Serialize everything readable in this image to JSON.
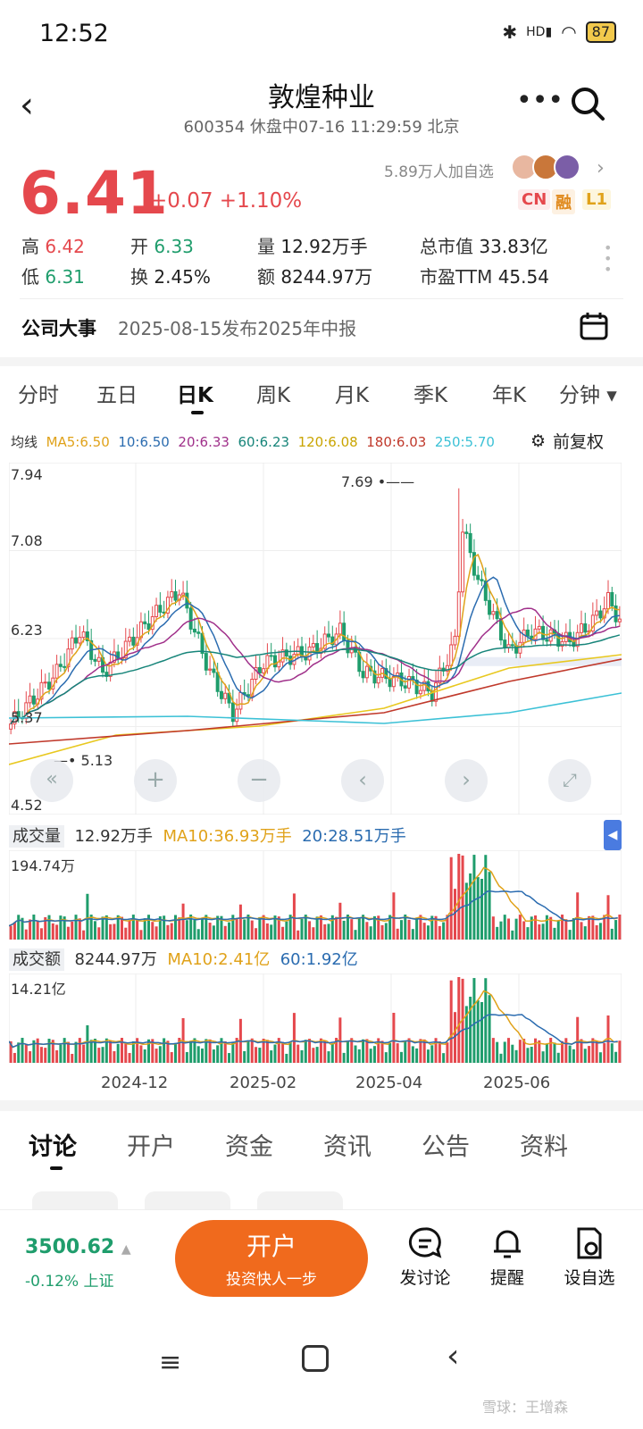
{
  "status": {
    "time": "12:52",
    "battery": "87",
    "network": "HD"
  },
  "header": {
    "title": "敦煌种业",
    "subtitle": "600354 休盘中07-16 11:29:59 北京"
  },
  "quote": {
    "price": "6.41",
    "change": "+0.07 +1.10%",
    "followers": "5.89万人加自选",
    "tags": [
      "CN",
      "融",
      "L1"
    ],
    "stats": {
      "high_label": "高",
      "high": "6.42",
      "low_label": "低",
      "low": "6.31",
      "open_label": "开",
      "open": "6.33",
      "turnover_label": "换",
      "turnover": "2.45%",
      "volume_label": "量",
      "volume": "12.92万手",
      "amount_label": "额",
      "amount": "8244.97万",
      "mktcap_label": "总市值",
      "mktcap": "33.83亿",
      "pe_label": "市盈TTM",
      "pe": "45.54"
    }
  },
  "event": {
    "label": "公司大事",
    "text": "2025-08-15发布2025年中报"
  },
  "chart_tabs": [
    "分时",
    "五日",
    "日K",
    "周K",
    "月K",
    "季K",
    "年K",
    "分钟 ▾"
  ],
  "ma_row": {
    "label": "均线",
    "ma5": "MA5:6.50",
    "ma10": "10:6.50",
    "ma20": "20:6.33",
    "ma60": "60:6.23",
    "ma120": "120:6.08",
    "ma180": "180:6.03",
    "ma250": "250:5.70",
    "adjust": "前复权"
  },
  "colors": {
    "up": "#e5484d",
    "down": "#1f9d6c",
    "ma5": "#e0a21a",
    "ma10": "#2b6cb0",
    "ma20": "#a0308a",
    "ma60": "#17857a",
    "ma120": "#e8c81f",
    "ma180": "#c0392b",
    "ma250": "#3cc1d6",
    "accent": "#f06a1d"
  },
  "chart_data": {
    "type": "candlestick",
    "y_ticks": [
      "7.94",
      "7.08",
      "6.23",
      "5.37",
      "4.52"
    ],
    "ylim": [
      4.52,
      7.94
    ],
    "annotations": {
      "max": "7.69",
      "min": "5.13"
    },
    "x_ticks": [
      "2024-12",
      "2025-02",
      "2025-04",
      "2025-06"
    ],
    "series": [
      {
        "name": "MA5",
        "last": 6.5
      },
      {
        "name": "MA10",
        "last": 6.5
      },
      {
        "name": "MA20",
        "last": 6.33
      },
      {
        "name": "MA60",
        "last": 6.23
      },
      {
        "name": "MA120",
        "last": 6.08
      },
      {
        "name": "MA180",
        "last": 6.03
      },
      {
        "name": "MA250",
        "last": 5.7
      }
    ],
    "volume": {
      "label": "成交量",
      "value": "12.92万手",
      "ma10": "MA10:36.93万手",
      "ma20": "20:28.51万手",
      "max": "194.74万"
    },
    "amount": {
      "label": "成交额",
      "value": "8244.97万",
      "ma10": "MA10:2.41亿",
      "ma60": "60:1.92亿",
      "max": "14.21亿"
    }
  },
  "bottom_tabs": [
    "讨论",
    "开户",
    "资金",
    "资讯",
    "公告",
    "资料"
  ],
  "bottom_bar": {
    "index_value": "3500.62",
    "index_sub": "-0.12% 上证",
    "open_main": "开户",
    "open_sub": "投资快人一步",
    "actions": [
      "发讨论",
      "提醒",
      "设自选"
    ]
  },
  "watermark": "雪球：王增森"
}
